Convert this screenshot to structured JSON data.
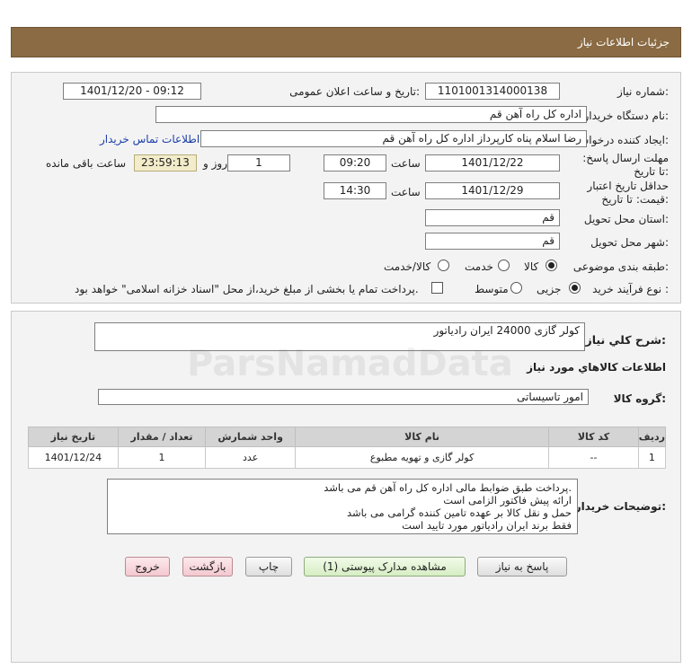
{
  "header": {
    "title": "جزئیات اطلاعات نیاز"
  },
  "form": {
    "need_number": {
      "label": "شماره نیاز:",
      "value": "1101001314000138"
    },
    "announce_datetime": {
      "label": "تاریخ و ساعت اعلان عمومی:",
      "value": "1401/12/20 - 09:12"
    },
    "buyer_org": {
      "label": "نام دستگاه خریدار:",
      "value": "اداره کل  راه آهن قم"
    },
    "requester": {
      "label": "ایجاد کننده درخواست:",
      "value": "رضا اسلام پناه کارپرداز اداره کل  راه آهن قم",
      "contact_link": "اطلاعات تماس خریدار"
    },
    "reply_deadline": {
      "label": "مهلت ارسال پاسخ: تا تاریخ:",
      "date": "1401/12/22",
      "time_label": "ساعت",
      "time": "09:20",
      "days": "1",
      "days_label": "روز و",
      "remaining": "23:59:13",
      "remaining_label": "ساعت باقی مانده"
    },
    "price_validity": {
      "label": "حداقل تاریخ اعتبار قیمت: تا تاریخ:",
      "date": "1401/12/29",
      "time_label": "ساعت",
      "time": "14:30"
    },
    "delivery_province": {
      "label": "استان محل تحویل:",
      "value": "قم"
    },
    "delivery_city": {
      "label": "شهر محل تحویل:",
      "value": "قم"
    },
    "category": {
      "label": "طبقه بندی موضوعی:",
      "options": [
        "کالا",
        "خدمت",
        "کالا/خدمت"
      ],
      "selected": "کالا"
    },
    "process_type": {
      "label": "نوع فرآیند خرید :",
      "options": [
        "جزیی",
        "متوسط"
      ],
      "selected": "جزیی",
      "payment_note": "پرداخت تمام یا بخشی از مبلغ خرید،از محل \"اسناد خزانه اسلامی\" خواهد بود."
    }
  },
  "details": {
    "summary_label": "شرح کلي نياز:",
    "summary_value": "کولر گازی 24000 ایران رادیاتور",
    "items_heading": "اطلاعات کالاهاي مورد نياز",
    "group_label": "گروه کالا:",
    "group_value": "امور تاسیساتی",
    "table": {
      "headers": [
        "ردیف",
        "کد کالا",
        "نام کالا",
        "واحد شمارش",
        "تعداد / مقدار",
        "تاریخ نیاز"
      ],
      "rows": [
        [
          "1",
          "--",
          "کولر گازی و تهویه مطبوع",
          "عدد",
          "1",
          "1401/12/24"
        ]
      ]
    },
    "notes_label": "توضیحات خریدار:",
    "notes": [
      "پرداخت طبق ضوابط مالی اداره کل راه آهن قم می باشد.",
      "ارائه پیش فاکتور الزامی است",
      "حمل و نقل کالا بر عهده تامین کننده گرامی می باشد",
      "فقط برند ایران رادیاتور مورد تایید است"
    ]
  },
  "buttons": {
    "reply": "پاسخ به نیاز",
    "attachments": "مشاهده مدارک پیوستی (1)",
    "print": "چاپ",
    "back": "بازگشت",
    "exit": "خروج"
  },
  "watermark": {
    "brand": "ParsNamadData"
  }
}
